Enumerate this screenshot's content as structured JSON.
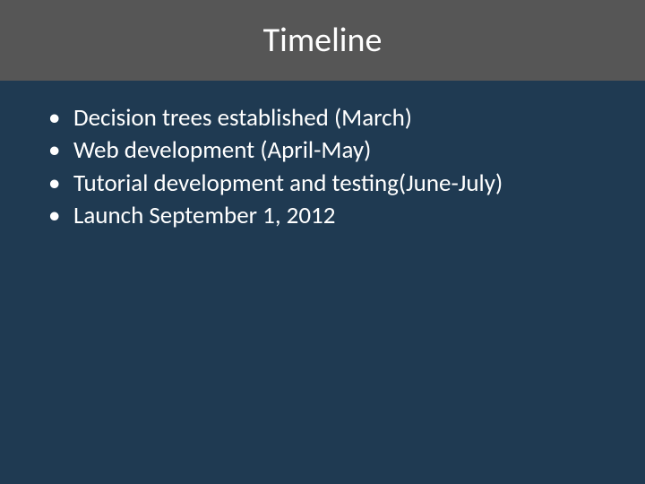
{
  "title": "Timeline",
  "bullets": {
    "item0": "Decision trees established (March)",
    "item1": "Web development (April-May)",
    "item2": "Tutorial development and testing(June-July)",
    "item3": "Launch September 1, 2012"
  }
}
